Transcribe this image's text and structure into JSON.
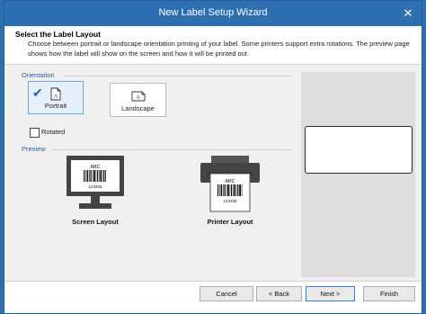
{
  "window": {
    "title": "New Label Setup Wizard",
    "close_glyph": "✕"
  },
  "header": {
    "title": "Select the Label Layout",
    "description": "Choose between portrait or landscape orientation printing of your label. Some printers support extra rotations. The preview page shows how the label will show on the screen and how it will be printed out."
  },
  "orientation": {
    "section_label": "Orientation",
    "portrait_label": "Portrait",
    "landscape_label": "Landscape",
    "selected": "Portrait",
    "rotated_label": "Rotated",
    "rotated_checked": false,
    "icon_letter": "A"
  },
  "preview": {
    "section_label": "Preview",
    "barcode_text": "ABC",
    "barcode_number": "123456",
    "screen_label": "Screen Layout",
    "printer_label": "Printer Layout"
  },
  "buttons": {
    "cancel": "Cancel",
    "back": "< Back",
    "next": "Next >",
    "finish": "Finish"
  },
  "colors": {
    "titlebar": "#2d6fb1",
    "accent": "#1e63b0",
    "section": "#2d5f9a"
  },
  "icons": [
    "close-icon",
    "portrait-icon",
    "landscape-icon",
    "checkmark-icon",
    "monitor-icon",
    "printer-icon",
    "barcode-icon"
  ]
}
